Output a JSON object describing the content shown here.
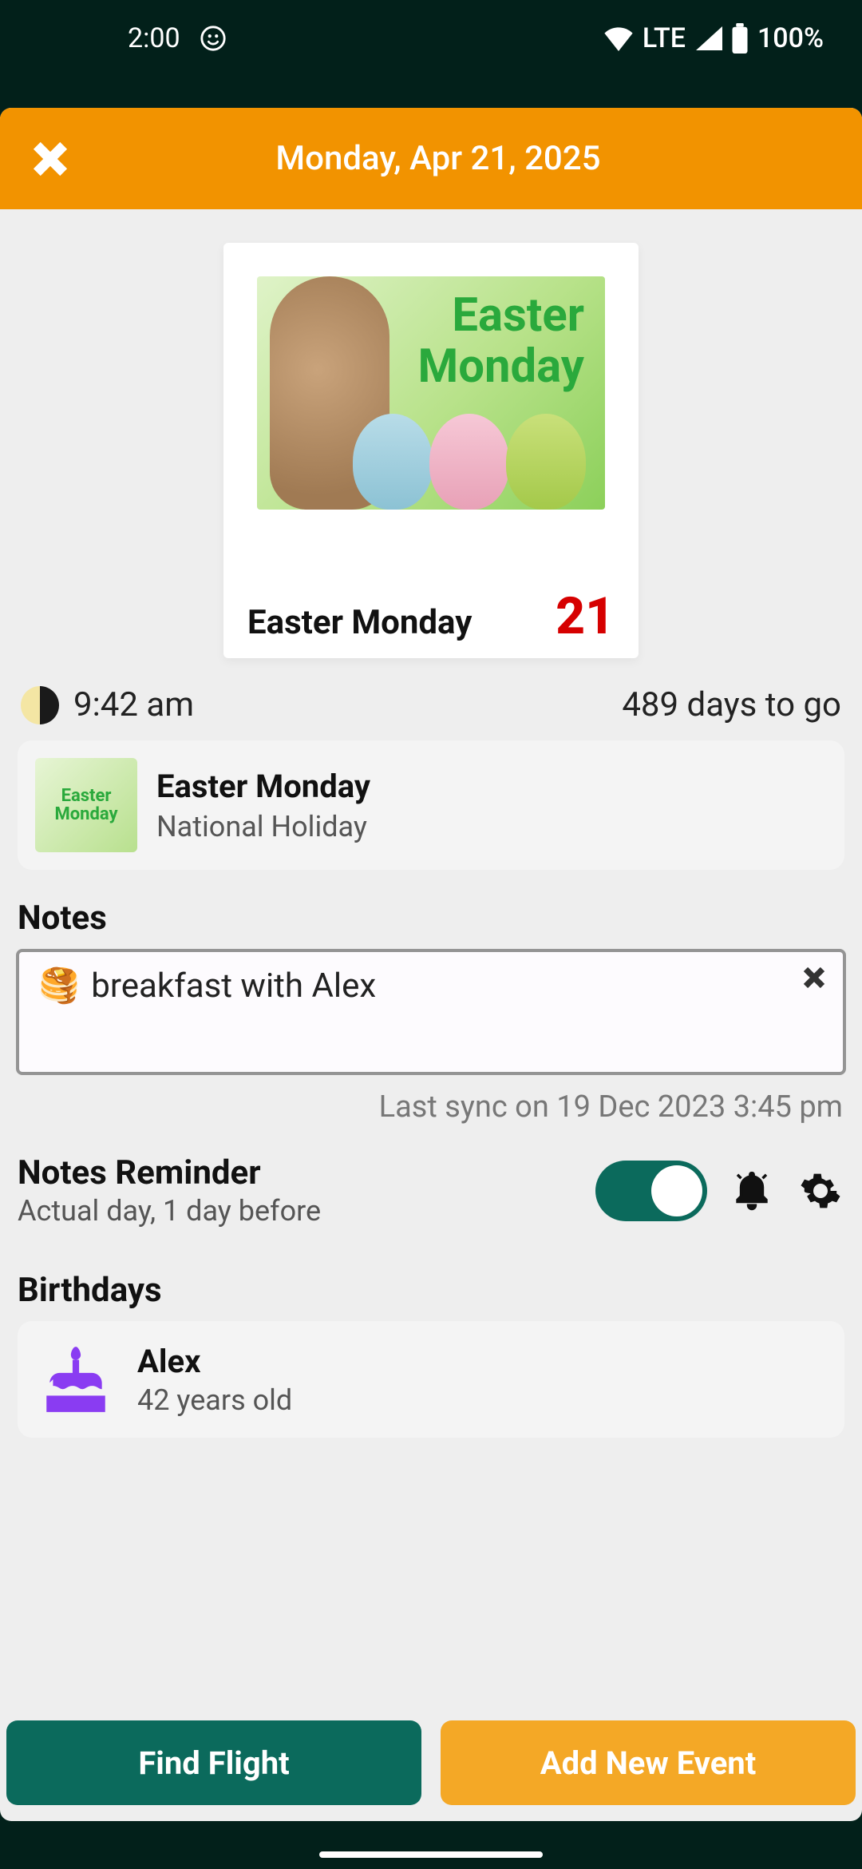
{
  "status": {
    "time": "2:00",
    "network": "LTE",
    "battery": "100%"
  },
  "header": {
    "title": "Monday, Apr 21, 2025"
  },
  "hero": {
    "overlay_text": "Easter\nMonday",
    "name": "Easter Monday",
    "day": "21"
  },
  "info": {
    "moonrise_time": "9:42 am",
    "days_left": "489 days to go"
  },
  "holiday_card": {
    "thumb_text": "Easter\nMonday",
    "title": "Easter Monday",
    "subtitle": "National Holiday"
  },
  "notes": {
    "section_title": "Notes",
    "emoji": "🥞",
    "text": "breakfast with Alex",
    "last_sync": "Last sync on 19 Dec 2023 3:45 pm"
  },
  "reminder": {
    "title": "Notes Reminder",
    "subtitle": "Actual day, 1 day before",
    "enabled": true
  },
  "birthdays": {
    "section_title": "Birthdays",
    "items": [
      {
        "name": "Alex",
        "age_text": "42 years old"
      }
    ]
  },
  "actions": {
    "find_flight": "Find Flight",
    "add_event": "Add New Event"
  },
  "colors": {
    "brand_orange": "#f29300",
    "brand_teal": "#0b6a5c",
    "accent_purple": "#8a3cf2"
  }
}
